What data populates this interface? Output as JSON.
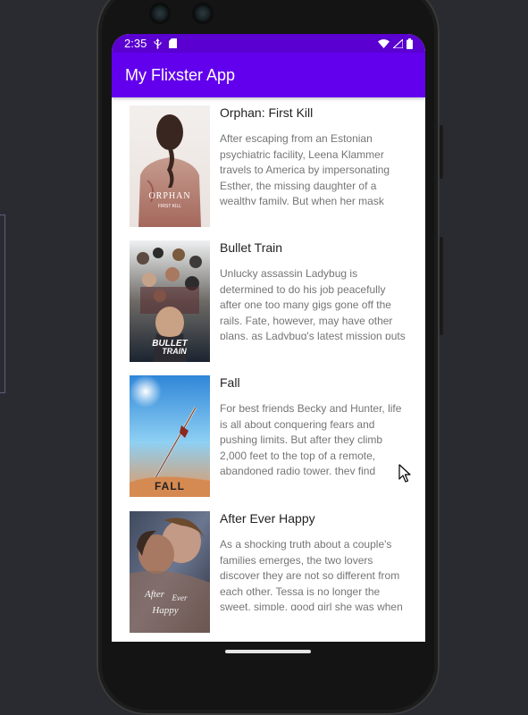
{
  "status_bar": {
    "time": "2:35"
  },
  "app_bar": {
    "title": "My Flixster App"
  },
  "movies": [
    {
      "title": "Orphan: First Kill",
      "overview": "After escaping from an Estonian psychiatric facility, Leena Klammer travels to America by impersonating Esther, the missing daughter of a wealthy family. But when her mask starts to slip, she is put against a mother",
      "poster_text": [
        "ORPHAN",
        "FIRST KILL"
      ]
    },
    {
      "title": "Bullet Train",
      "overview": "Unlucky assassin Ladybug is determined to do his job peacefully after one too many gigs gone off the rails. Fate, however, may have other plans, as Ladybug's latest mission puts him on a collision course with lethal adversaries",
      "poster_text": [
        "BULLET",
        "TRAIN"
      ]
    },
    {
      "title": "Fall",
      "overview": "For best friends Becky and Hunter, life is all about conquering fears and pushing limits. But after they climb 2,000 feet to the top of a remote, abandoned radio tower, they find themselves stranded with no way down. Now Becky and",
      "poster_text": [
        "FALL"
      ]
    },
    {
      "title": "After Ever Happy",
      "overview": "As a shocking truth about a couple's families emerges, the two lovers discover they are not so different from each other. Tessa is no longer the sweet, simple, good girl she was when she met Hardin — any more than he is the cruel",
      "poster_text": [
        "After",
        "Ever",
        "Happy"
      ]
    }
  ]
}
